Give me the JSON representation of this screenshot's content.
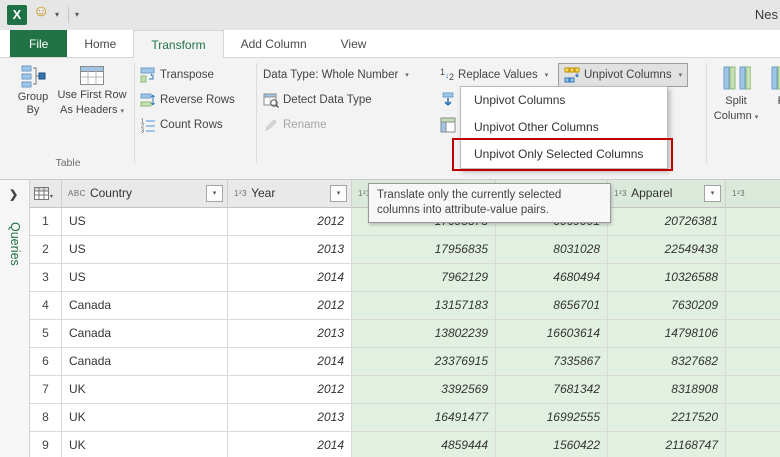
{
  "window": {
    "title": "Nes"
  },
  "titlebar": {
    "smiley": "☺"
  },
  "tabs": [
    {
      "id": "file",
      "label": "File"
    },
    {
      "id": "home",
      "label": "Home"
    },
    {
      "id": "transform",
      "label": "Transform"
    },
    {
      "id": "add-column",
      "label": "Add Column"
    },
    {
      "id": "view",
      "label": "View"
    }
  ],
  "ribbon": {
    "group_by_label": "Group By",
    "use_first_row_line1": "Use First Row",
    "use_first_row_line2": "As Headers",
    "table_group_label": "Table",
    "transpose_label": "Transpose",
    "reverse_rows_label": "Reverse Rows",
    "count_rows_label": "Count Rows",
    "data_type_label": "Data Type: Whole Number",
    "detect_data_type_label": "Detect Data Type",
    "rename_label": "Rename",
    "replace_values_label": "Replace Values",
    "unpivot_columns_label": "Unpivot Columns",
    "split_line1": "Split",
    "split_line2": "Column",
    "format_partial_label": "Fo"
  },
  "dropdown_menu": {
    "items": [
      {
        "label": "Unpivot Columns",
        "highlighted": false
      },
      {
        "label": "Unpivot Other Columns",
        "highlighted": false
      },
      {
        "label": "Unpivot Only Selected Columns",
        "highlighted": true
      }
    ]
  },
  "tooltip": {
    "text": "Translate only the currently selected columns into attribute-value pairs."
  },
  "sidebar": {
    "expand_glyph": "❯",
    "pane_label": "Queries"
  },
  "grid": {
    "headers": [
      {
        "type": "ABC",
        "label": "Country",
        "selected": false
      },
      {
        "type": "1²3",
        "label": "Year",
        "selected": false
      },
      {
        "type": "1²3",
        "label": "E",
        "selected": true
      },
      {
        "type": "",
        "label": "",
        "selected": true
      },
      {
        "type": "1²3",
        "label": "Apparel",
        "selected": true
      },
      {
        "type": "1²3",
        "label": "",
        "selected": true
      }
    ],
    "rows": [
      {
        "n": "1",
        "country": "US",
        "year": "2012",
        "v1": "17693575",
        "v2": "6069001",
        "v3": "20726381"
      },
      {
        "n": "2",
        "country": "US",
        "year": "2013",
        "v1": "17956835",
        "v2": "8031028",
        "v3": "22549438"
      },
      {
        "n": "3",
        "country": "US",
        "year": "2014",
        "v1": "7962129",
        "v2": "4680494",
        "v3": "10326588"
      },
      {
        "n": "4",
        "country": "Canada",
        "year": "2012",
        "v1": "13157183",
        "v2": "8656701",
        "v3": "7630209"
      },
      {
        "n": "5",
        "country": "Canada",
        "year": "2013",
        "v1": "13802239",
        "v2": "16603614",
        "v3": "14798106"
      },
      {
        "n": "6",
        "country": "Canada",
        "year": "2014",
        "v1": "23376915",
        "v2": "7335867",
        "v3": "8327682"
      },
      {
        "n": "7",
        "country": "UK",
        "year": "2012",
        "v1": "3392569",
        "v2": "7681342",
        "v3": "8318908"
      },
      {
        "n": "8",
        "country": "UK",
        "year": "2013",
        "v1": "16491477",
        "v2": "16992555",
        "v3": "2217520"
      },
      {
        "n": "9",
        "country": "UK",
        "year": "2014",
        "v1": "4859444",
        "v2": "1560422",
        "v3": "21168747"
      }
    ]
  },
  "colors": {
    "accent_green": "#217346",
    "selection_green": "#e2f0e2",
    "annotation_red": "#c00000"
  }
}
